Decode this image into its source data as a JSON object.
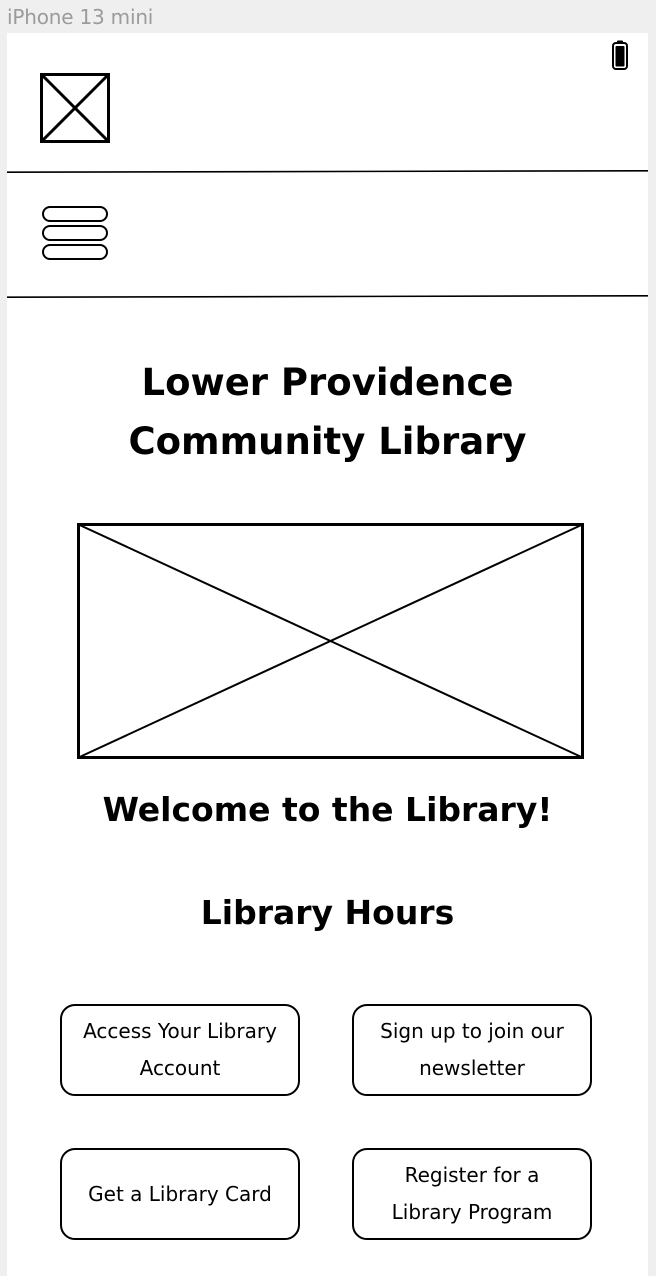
{
  "frame": {
    "label": "iPhone 13 mini"
  },
  "header": {
    "logo_icon": "image-placeholder-icon",
    "battery_icon": "battery-icon",
    "menu_icon": "hamburger-menu-icon"
  },
  "main": {
    "title_line1": "Lower Providence",
    "title_line2": "Community Library",
    "hero_image": "image-placeholder-icon",
    "welcome": "Welcome to the Library!",
    "hours_heading": "Library Hours"
  },
  "actions": [
    {
      "label": "Access Your Library Account"
    },
    {
      "label": "Sign up to join our newsletter"
    },
    {
      "label": "Get a Library Card"
    },
    {
      "label": "Register for a Library Program"
    }
  ]
}
